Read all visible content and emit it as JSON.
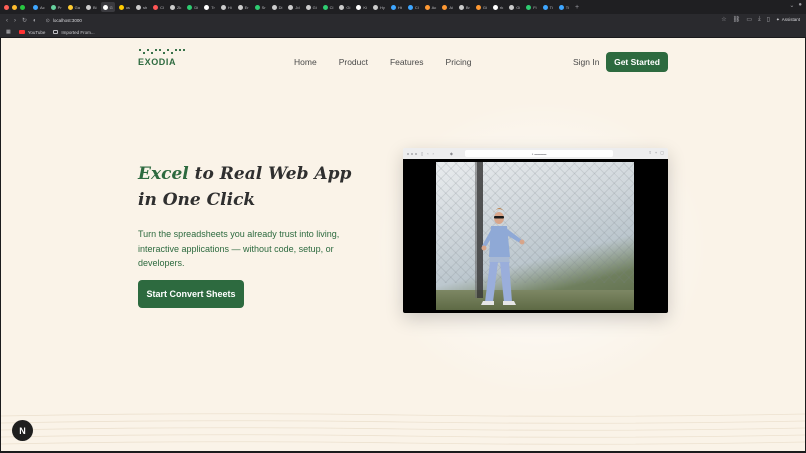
{
  "browser": {
    "tabs": [
      {
        "label": "Ac",
        "color": "#3ea6ff"
      },
      {
        "label": "Pr",
        "color": "#66d19e"
      },
      {
        "label": "Ga",
        "color": "#ffcc33"
      },
      {
        "label": "Bi",
        "color": "#cccccc"
      },
      {
        "label": "G",
        "color": "#ffffff",
        "active": true
      },
      {
        "label": "us",
        "color": "#ffcc00"
      },
      {
        "label": "sh",
        "color": "#cccccc"
      },
      {
        "label": "Cl",
        "color": "#ff5555"
      },
      {
        "label": "Zk",
        "color": "#cccccc"
      },
      {
        "label": "Di",
        "color": "#2ecc71"
      },
      {
        "label": "Tr",
        "color": "#ffffff"
      },
      {
        "label": "Hi",
        "color": "#cccccc"
      },
      {
        "label": "Er",
        "color": "#cccccc"
      },
      {
        "label": "Sr",
        "color": "#2ecc71"
      },
      {
        "label": "Di",
        "color": "#cccccc"
      },
      {
        "label": "Jd",
        "color": "#cccccc"
      },
      {
        "label": "Gi",
        "color": "#cccccc"
      },
      {
        "label": "Cl",
        "color": "#2ecc71"
      },
      {
        "label": "Gi",
        "color": "#cccccc"
      },
      {
        "label": "Ki",
        "color": "#ffffff"
      },
      {
        "label": "Hy",
        "color": "#cccccc"
      },
      {
        "label": "Ht",
        "color": "#3ea6ff"
      },
      {
        "label": "Cl",
        "color": "#3ea6ff"
      },
      {
        "label": "Ac",
        "color": "#ff9933"
      },
      {
        "label": "Ai",
        "color": "#ff9933"
      },
      {
        "label": "Br",
        "color": "#cccccc"
      },
      {
        "label": "Gi",
        "color": "#ff9933"
      },
      {
        "label": "rk",
        "color": "#ffffff"
      },
      {
        "label": "Gi",
        "color": "#cccccc"
      },
      {
        "label": "Fi",
        "color": "#2ecc71"
      },
      {
        "label": "Ti",
        "color": "#3ea6ff"
      },
      {
        "label": "Ti",
        "color": "#3ea6ff"
      }
    ],
    "url": "localhost:3000",
    "assistant_label": "Assistant",
    "bookmarks": [
      {
        "label": "YouTube",
        "icon": "youtube-icon"
      },
      {
        "label": "Imported From...",
        "icon": "folder-icon"
      }
    ]
  },
  "site": {
    "logo_text": "EXODIA",
    "nav": [
      "Home",
      "Product",
      "Features",
      "Pricing"
    ],
    "sign_in": "Sign In",
    "cta": "Get Started",
    "hero": {
      "title_accent": "Excel",
      "title_line1_rest": " to Real Web App",
      "title_line2": "in One Click",
      "subtitle": "Turn the spreadsheets you already trust into living, interactive applications — without code, setup, or developers.",
      "button": "Start Convert Sheets"
    },
    "floating_badge": "N",
    "colors": {
      "brand": "#2d6a3f",
      "background": "#faf3e8"
    }
  }
}
